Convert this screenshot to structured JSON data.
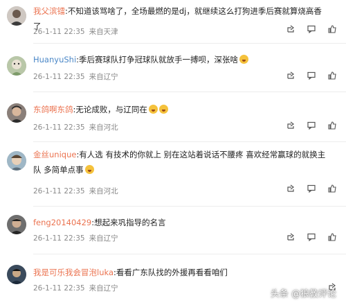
{
  "comments": [
    {
      "username": "我父滨镭",
      "username_color": "orange",
      "text": ":不知道该骂啥了，全场最燃的是dj，就继续这么打狗进季后赛就算烧高香了",
      "time": "26-1-11 22:35",
      "location": "来自天津",
      "emoji": []
    },
    {
      "username": "HuanyuShi",
      "username_color": "blue",
      "text": ":季后赛球队打争冠球队就放手一搏呗，深张啥",
      "time": "26-1-11 22:35",
      "location": "来自辽宁",
      "emoji": [
        "smile-emoji"
      ]
    },
    {
      "username": "东鸽啊东鸽",
      "username_color": "orange",
      "text": ":无论成败，与辽同在",
      "time": "26-1-11 22:35",
      "location": "来自河北",
      "emoji": [
        "shock-emoji",
        "shock-emoji"
      ]
    },
    {
      "username": "金丝unique",
      "username_color": "orange",
      "text": ":有人选 有技术的你就上 别在这站着说话不腰疼 喜欢经常赢球的就换主队 多简单点事",
      "time": "26-1-11 22:35",
      "location": "来自河北",
      "emoji": [
        "laugh-emoji"
      ]
    },
    {
      "username": "feng20140429",
      "username_color": "orange",
      "text": ":想起来巩指导的名言",
      "time": "26-1-11 22:35",
      "location": "来自辽宁",
      "emoji": []
    },
    {
      "username": "我是可乐我会冒泡luka",
      "username_color": "orange",
      "text": ":看看广东队找的外援再看看咱们",
      "time": "26-1-11 22:35",
      "location": "来自辽宁",
      "emoji": []
    }
  ],
  "actions": [
    "share-icon",
    "comment-icon",
    "like-icon"
  ],
  "watermark": "头条 @狼教评论"
}
